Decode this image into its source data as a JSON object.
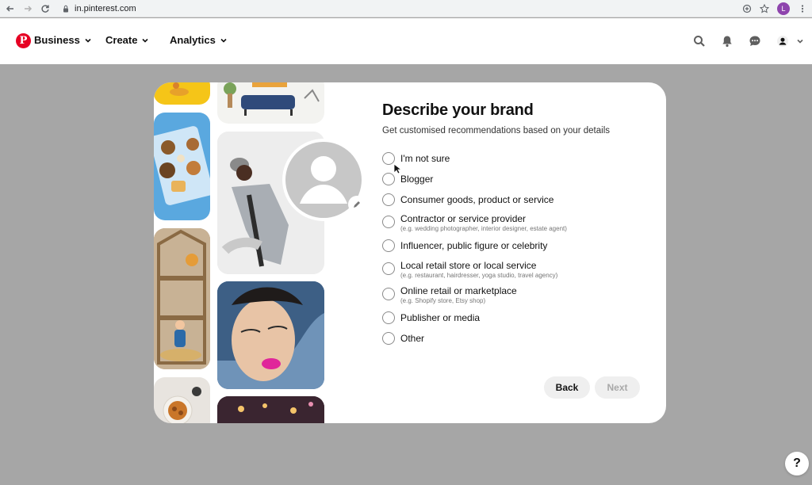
{
  "browser": {
    "url": "in.pinterest.com",
    "profile_initial": "L"
  },
  "header": {
    "menus": [
      {
        "label": "Business"
      },
      {
        "label": "Create"
      },
      {
        "label": "Analytics"
      }
    ],
    "icons": [
      "search-icon",
      "bell-icon",
      "chat-icon",
      "account-icon",
      "chevron-down-icon"
    ]
  },
  "modal": {
    "title": "Describe your brand",
    "subtitle": "Get customised recommendations based on your details",
    "options": [
      {
        "label": "I'm not sure",
        "hint": "",
        "selected": false
      },
      {
        "label": "Blogger",
        "hint": "",
        "selected": false
      },
      {
        "label": "Consumer goods, product or service",
        "hint": "",
        "selected": false
      },
      {
        "label": "Contractor or service provider",
        "hint": "(e.g. wedding photographer, interior designer, estate agent)",
        "selected": false
      },
      {
        "label": "Influencer, public figure or celebrity",
        "hint": "",
        "selected": false
      },
      {
        "label": "Local retail store or local service",
        "hint": "(e.g. restaurant, hairdresser, yoga studio, travel agency)",
        "selected": false
      },
      {
        "label": "Online retail or marketplace",
        "hint": "(e.g. Shopify store, Etsy shop)",
        "selected": false
      },
      {
        "label": "Publisher or media",
        "hint": "",
        "selected": false
      },
      {
        "label": "Other",
        "hint": "",
        "selected": false
      }
    ],
    "back_label": "Back",
    "next_label": "Next"
  },
  "help_label": "?",
  "colors": {
    "brand": "#e60023",
    "backdrop": "#a6a6a6"
  }
}
